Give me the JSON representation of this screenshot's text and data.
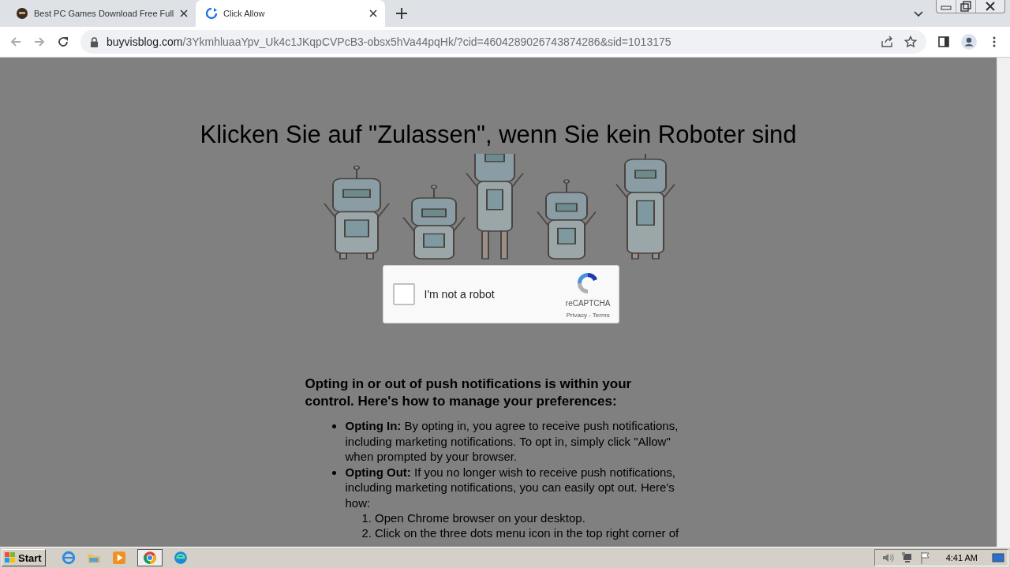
{
  "browser": {
    "tabs": [
      {
        "title": "Best PC Games Download Free Full",
        "selected": false
      },
      {
        "title": "Click Allow",
        "selected": true
      }
    ],
    "url": {
      "domain": "buyvisblog.com",
      "path": "/3YkmhluaaYpv_Uk4c1JKqpCVPcB3-obsx5hVa44pqHk/?cid=4604289026743874286&sid=1013175"
    }
  },
  "page": {
    "heading": "Klicken Sie auf \"Zulassen\", wenn Sie kein Roboter sind",
    "captcha": {
      "label": "I'm not a robot",
      "checked": false,
      "brand": "reCAPTCHA",
      "links": "Privacy - Terms"
    },
    "intro": "Opting in or out of push notifications is within your control. Here's how to manage your preferences:",
    "items": [
      {
        "text": "**Opting In:** By opting in, you agree to receive push notifications, including marketing notifications. To opt in, simply click \"Allow\" when prompted by your browser."
      },
      {
        "text": "**Opting Out:** If you no longer wish to receive push notifications, including marketing notifications, you can easily opt out. Here's how:",
        "steps": [
          {
            "number": "1.",
            "text": "Open Chrome browser on your desktop."
          },
          {
            "number": "2.",
            "text": "Click on the three dots menu icon in the top right corner of"
          }
        ]
      }
    ]
  },
  "taskbar": {
    "start": "Start",
    "clock": "4:41 AM"
  }
}
